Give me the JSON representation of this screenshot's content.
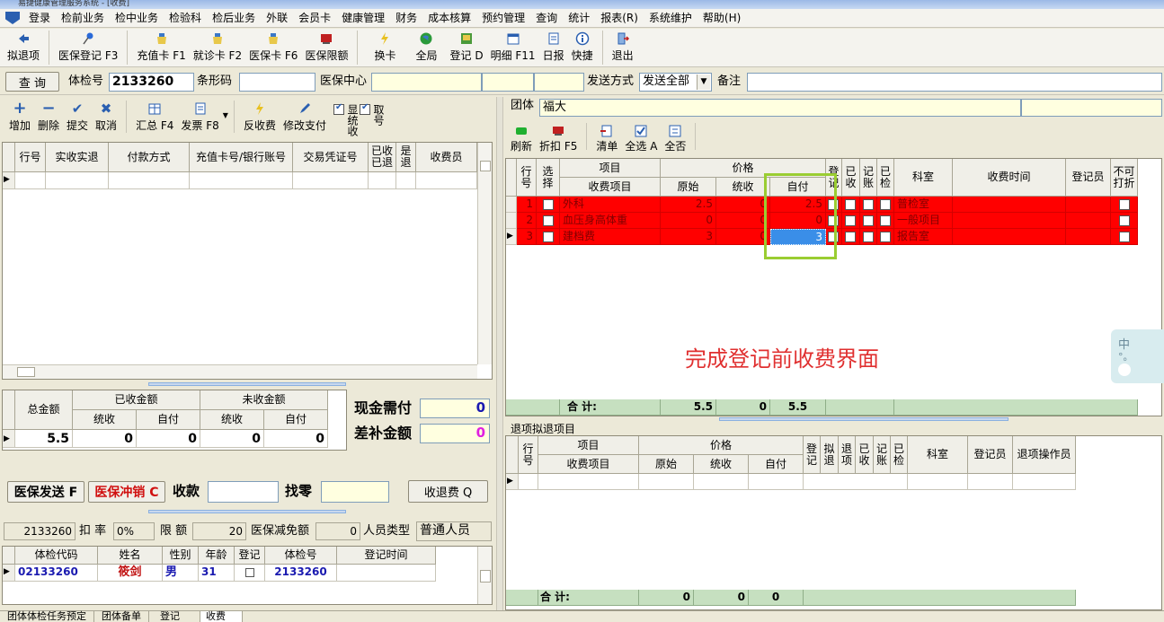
{
  "window": {
    "title": "易捷健康管理服务系统 - [收费]"
  },
  "menu": [
    "登录",
    "检前业务",
    "检中业务",
    "检验科",
    "检后业务",
    "外联",
    "会员卡",
    "健康管理",
    "财务",
    "成本核算",
    "预约管理",
    "查询",
    "统计",
    "报表(R)",
    "系统维护",
    "帮助(H)"
  ],
  "toolbar": [
    {
      "label": "拟退项",
      "icon": "return-icon"
    },
    {
      "label": "医保登记 F3",
      "icon": "pin-icon"
    },
    {
      "label": "充值卡 F1",
      "icon": "card-icon"
    },
    {
      "label": "就诊卡 F2",
      "icon": "card-icon"
    },
    {
      "label": "医保卡 F6",
      "icon": "card-icon"
    },
    {
      "label": "医保限额",
      "icon": "limit-icon"
    },
    {
      "label": "换卡",
      "icon": "lightning-icon"
    },
    {
      "label": "全局",
      "icon": "globe-icon"
    },
    {
      "label": "登记 D",
      "icon": "register-icon"
    },
    {
      "label": "明细 F11",
      "icon": "calendar-icon"
    },
    {
      "label": "日报",
      "icon": "report-icon"
    },
    {
      "label": "快捷",
      "icon": "info-icon"
    },
    {
      "label": "退出",
      "icon": "exit-icon"
    }
  ],
  "search": {
    "query_button": "查 询",
    "exam_no_label": "体检号",
    "exam_no_value": "2133260",
    "barcode_label": "条形码",
    "barcode_value": "",
    "insurance_center_label": "医保中心",
    "send_mode_label": "发送方式",
    "send_mode_value": "发送全部",
    "remark_label": "备注",
    "remark_value": ""
  },
  "payment_toolbar": [
    {
      "label": "增加",
      "icon": "plus-icon"
    },
    {
      "label": "删除",
      "icon": "minus-icon"
    },
    {
      "label": "提交",
      "icon": "check-icon"
    },
    {
      "label": "取消",
      "icon": "x-icon"
    },
    {
      "label": "汇总 F4",
      "icon": "summary-icon"
    },
    {
      "label": "发票 F8",
      "icon": "invoice-icon"
    },
    {
      "label": "反收费",
      "icon": "lightning-icon"
    },
    {
      "label": "修改支付",
      "icon": "pen-icon"
    }
  ],
  "payment_checks": {
    "show_unified": "显统收",
    "take_back": "取号"
  },
  "payment_grid": {
    "headers": [
      "行号",
      "实收实退",
      "付款方式",
      "充值卡号/银行账号",
      "交易凭证号",
      "已收已退",
      "是退",
      "收费员"
    ]
  },
  "amounts": {
    "total_label": "总金额",
    "received_label": "已收金额",
    "unreceived_label": "未收金额",
    "unified_label": "统收",
    "self_label": "自付",
    "total": "5.5",
    "received_unified": "0",
    "received_self": "0",
    "unreceived_unified": "0",
    "unreceived_self": "0"
  },
  "cash": {
    "cash_need_label": "现金需付",
    "cash_need_value": "0",
    "diff_label": "差补金额",
    "diff_value": "0"
  },
  "actions": {
    "insurance_send": "医保发送 F",
    "insurance_cancel": "医保冲销 C",
    "receive_label": "收款",
    "receive_value": "",
    "change_label": "找零",
    "change_value": "",
    "refund_button": "收退费 Q"
  },
  "patient_info": {
    "exam_no": "2133260",
    "discount_label": "扣 率",
    "discount_value": "0%",
    "limit_label": "限 额",
    "limit_value": "20",
    "insurance_reduce_label": "医保减免额",
    "insurance_reduce_value": "0",
    "person_type_label": "人员类型",
    "person_type_value": "普通人员"
  },
  "patient_grid": {
    "headers": [
      "体检代码",
      "姓名",
      "性别",
      "年龄",
      "登记",
      "体检号",
      "登记时间"
    ],
    "rows": [
      {
        "code": "02133260",
        "name": "筱剑",
        "gender": "男",
        "age": "31",
        "exam_no": "2133260",
        "time": ""
      }
    ]
  },
  "group": {
    "label": "团体",
    "value": "福大"
  },
  "right_toolbar": [
    {
      "label": "刷新",
      "icon": "refresh-icon"
    },
    {
      "label": "折扣 F5",
      "icon": "discount-icon"
    },
    {
      "label": "清单",
      "icon": "list-icon"
    },
    {
      "label": "全选 A",
      "icon": "select-all-icon"
    },
    {
      "label": "全否",
      "icon": "select-none-icon"
    }
  ],
  "items_grid": {
    "headers": {
      "row": "行号",
      "select": "选择",
      "item": "项目",
      "fee_item": "收费项目",
      "price": "价格",
      "original": "原始",
      "unified": "统收",
      "self": "自付",
      "register": "登记",
      "received": "已收",
      "account": "记账",
      "checked": "已检",
      "dept": "科室",
      "fee_time": "收费时间",
      "registrar": "登记员",
      "no_discount": "不可打折"
    },
    "rows": [
      {
        "row": "1",
        "name": "外科",
        "original": "2.5",
        "unified": "0",
        "self": "2.5",
        "dept": "普检室"
      },
      {
        "row": "2",
        "name": "血压身高体重",
        "original": "0",
        "unified": "0",
        "self": "0",
        "dept": "一般项目"
      },
      {
        "row": "3",
        "name": "建档费",
        "original": "3",
        "unified": "0",
        "self": "3",
        "dept": "报告室"
      }
    ],
    "total_label": "合 计:",
    "total_original": "5.5",
    "total_unified": "0",
    "total_self": "5.5"
  },
  "annotation": "完成登记前收费界面",
  "refund_section": {
    "title": "退项拟退项目",
    "headers": {
      "row": "行号",
      "item": "项目",
      "fee_item": "收费项目",
      "price": "价格",
      "original": "原始",
      "unified": "统收",
      "self": "自付",
      "register": "登记",
      "proposed": "拟退",
      "refunded": "退项",
      "received": "已收",
      "account": "记账",
      "checked": "已检",
      "dept": "科室",
      "registrar": "登记员",
      "refund_operator": "退项操作员"
    },
    "total_label": "合 计:",
    "total_original": "0",
    "total_unified": "0",
    "total_self": "0"
  },
  "footer_tabs": [
    "团体体检任务预定",
    "团体备单",
    "登记",
    "收费"
  ],
  "ime": "中"
}
